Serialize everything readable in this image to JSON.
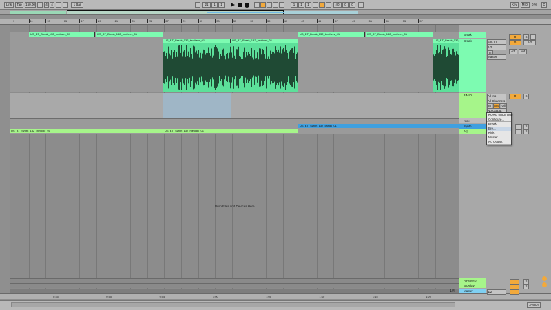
{
  "transport": {
    "link": "Link",
    "tap": "Tap",
    "tempo": "150.00",
    "sig_num": "4",
    "sig_den": "4",
    "quant": "1 Bar",
    "pos_bar": "21",
    "pos_beat": "1",
    "pos_six": "1",
    "loop_start_bar": "1",
    "loop_start_beat": "1",
    "loop_start_six": "1",
    "loop_len_bar": "40",
    "loop_len_beat": "0",
    "loop_len_six": "0"
  },
  "top_right": {
    "key": "Key",
    "midi": "MIDI",
    "cpu": "0 %",
    "d": "D"
  },
  "ruler": {
    "bars": [
      "9",
      "11",
      "13",
      "15",
      "17",
      "19",
      "21",
      "23",
      "25",
      "27",
      "29",
      "31",
      "33",
      "35",
      "37",
      "39",
      "41",
      "43",
      "45",
      "47",
      "49",
      "51",
      "53",
      "55",
      "57"
    ],
    "times": [
      "0:45",
      "0:50",
      "0:55",
      "1:00",
      "1:05",
      "1:10",
      "1:15",
      "1:20"
    ]
  },
  "clips": {
    "break_top": "US_BT_Break_132_brothers_01",
    "break_main": "US_BT_Break_132_brothers_01",
    "synth_candy": "US_BT_Synth_132_candy_01",
    "arp_melodic": "US_BT_Synth_132_melodic_01"
  },
  "tracks": {
    "break": "Break",
    "midi": "3 MIDI",
    "kick": "Kick",
    "synth": "Synth",
    "arp": "Arp",
    "reverb": "A Reverb",
    "delay": "B Delay",
    "master": "Master"
  },
  "io": {
    "ext_in": "Ext. In",
    "input_ch": "1/2",
    "in_out": "1/2",
    "master": "Master",
    "all_ins": "All Ins",
    "all_channels": "All Channels",
    "in": "In",
    "auto": "Auto",
    "off": "Off",
    "no_output": "No Output",
    "vol1": "0",
    "vol2": "0",
    "sends": "S",
    "inf": "-inf"
  },
  "dropdown": {
    "items": [
      "KORG (MIDI Out)",
      "Configure...",
      "Break",
      "Bre...",
      "Kick",
      "Master",
      "No Output"
    ]
  },
  "drop_hint": "Drop Files and Devices Here",
  "zoom": "1/4",
  "status_midi": "3-MIDI",
  "colors": {
    "clip_green": "#7dfbb1",
    "audio_bg": "#5ce09a",
    "wave": "#1f4a34",
    "synth_blue": "#3fa0e0",
    "arp_green": "#a6f58a",
    "selection": "#9fb6c6",
    "accent": "#f2a93b"
  }
}
